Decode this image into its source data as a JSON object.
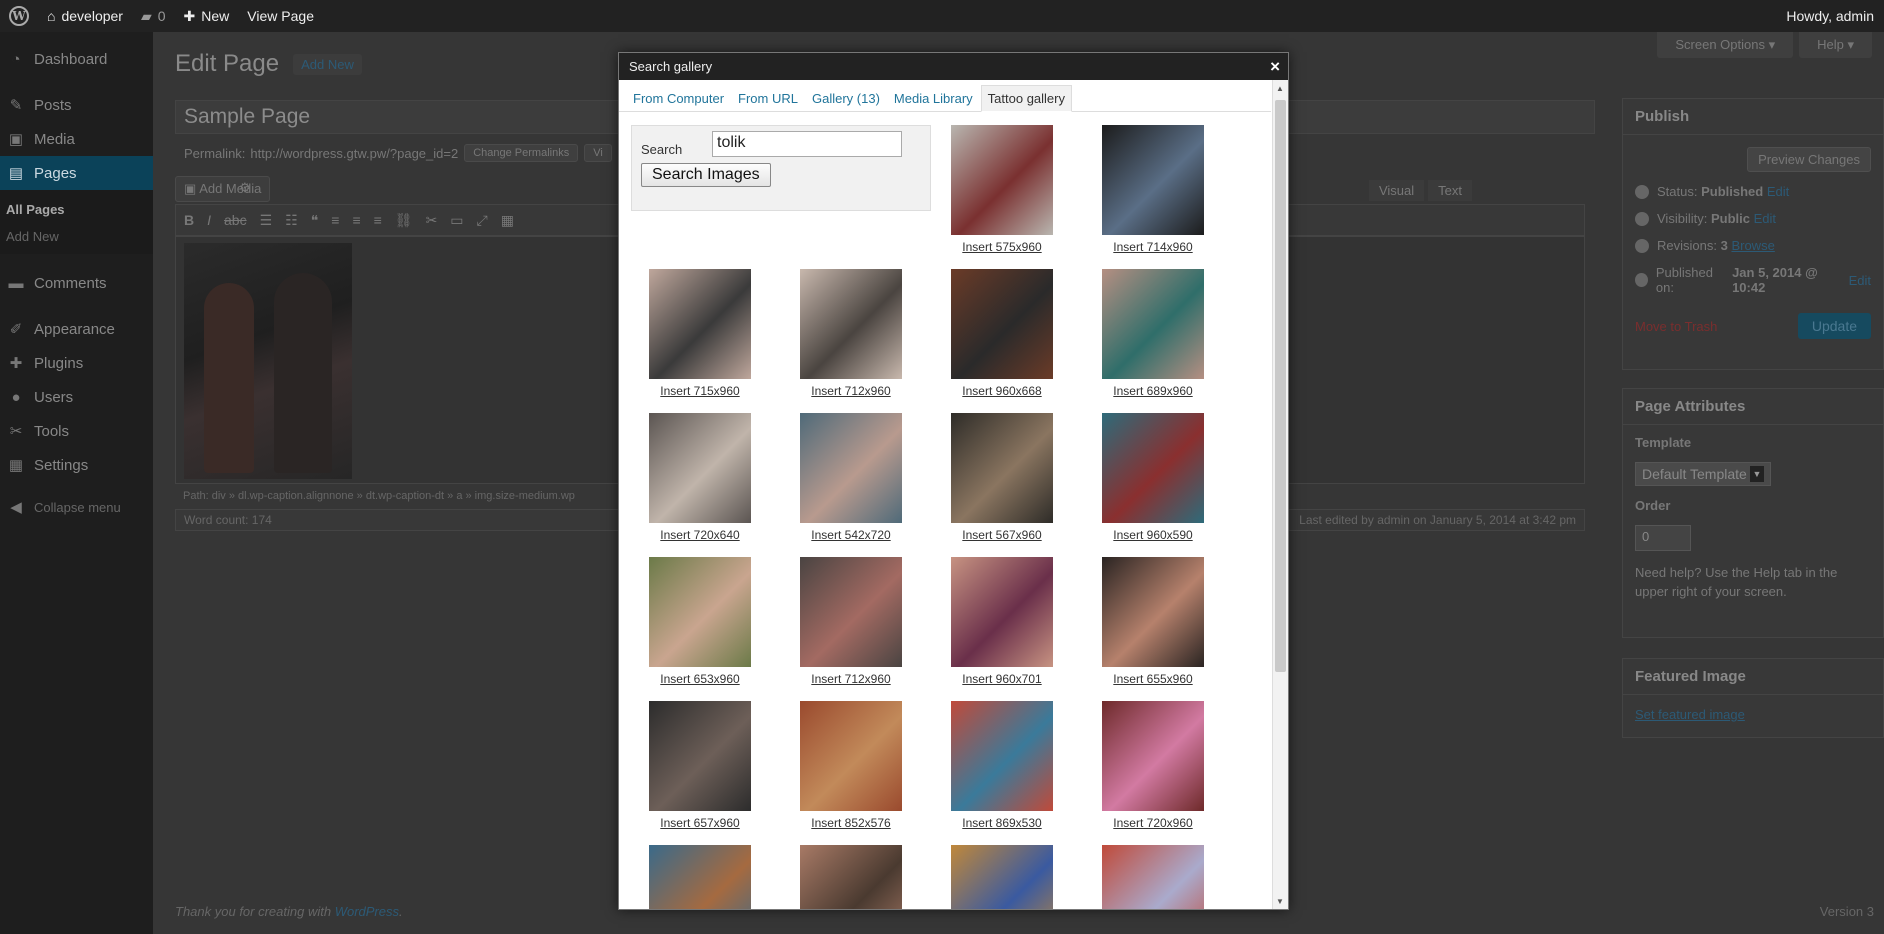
{
  "adminbar": {
    "site": "developer",
    "comments": "0",
    "new": "New",
    "view": "View Page",
    "howdy": "Howdy, admin"
  },
  "sidebar": {
    "items": [
      {
        "label": "Dashboard",
        "icon": "dashboard-icon",
        "glyph": "◔"
      },
      {
        "label": "Posts",
        "icon": "pin-icon",
        "glyph": "✎"
      },
      {
        "label": "Media",
        "icon": "media-icon",
        "glyph": "▣"
      },
      {
        "label": "Pages",
        "icon": "pages-icon",
        "glyph": "▤"
      }
    ],
    "sub": [
      "All Pages",
      "Add New"
    ],
    "items2": [
      {
        "label": "Comments",
        "icon": "comments-icon",
        "glyph": "▬"
      },
      {
        "label": "Appearance",
        "icon": "brush-icon",
        "glyph": "✐"
      },
      {
        "label": "Plugins",
        "icon": "plugin-icon",
        "glyph": "✚"
      },
      {
        "label": "Users",
        "icon": "users-icon",
        "glyph": "●"
      },
      {
        "label": "Tools",
        "icon": "wrench-icon",
        "glyph": "✂"
      },
      {
        "label": "Settings",
        "icon": "settings-icon",
        "glyph": "▦"
      }
    ],
    "collapse": "Collapse menu"
  },
  "page": {
    "title": "Edit Page",
    "add_new": "Add New",
    "screen_options": "Screen Options ▾",
    "help": "Help ▾",
    "post_title": "Sample Page",
    "permalink_label": "Permalink:",
    "permalink_url": "http://wordpress.gtw.pw/?page_id=2",
    "change_permalinks": "Change Permalinks",
    "view_page_short": "Vi",
    "add_media": "Add Media",
    "visual": "Visual",
    "text": "Text",
    "path": "Path: div » dl.wp-caption.alignnone » dt.wp-caption-dt » a » img.size-medium.wp",
    "word_count": "Word count: 174",
    "last_edited": "Last edited by admin on January 5, 2014 at 3:42 pm",
    "footer_text": "Thank you for creating with ",
    "footer_link": "WordPress",
    "version": "Version 3"
  },
  "publish": {
    "title": "Publish",
    "preview": "Preview Changes",
    "status_label": "Status:",
    "status": "Published",
    "visibility_label": "Visibility:",
    "visibility": "Public",
    "revisions_label": "Revisions:",
    "revisions": "3",
    "browse": "Browse",
    "published_label": "Published on:",
    "published": "Jan 5, 2014 @ 10:42",
    "edit": "Edit",
    "trash": "Move to Trash",
    "update": "Update"
  },
  "attributes": {
    "title": "Page Attributes",
    "template_label": "Template",
    "template": "Default Template",
    "order_label": "Order",
    "order": "0",
    "help": "Need help? Use the Help tab in the upper right of your screen."
  },
  "featured": {
    "title": "Featured Image",
    "link": "Set featured image"
  },
  "modal": {
    "title": "Search gallery",
    "close": "×",
    "tabs": [
      "From Computer",
      "From URL",
      "Gallery (13)",
      "Media Library",
      "Tattoo gallery"
    ],
    "active_tab": 4,
    "search_label": "Search",
    "search_value": "tolik",
    "search_button": "Search Images",
    "images": [
      {
        "label": "Insert 575x960",
        "colors": [
          "#b9b6b0",
          "#7a3030"
        ]
      },
      {
        "label": "Insert 714x960",
        "colors": [
          "#1c1c1c",
          "#5a6e86"
        ]
      },
      {
        "label": "Insert 715x960",
        "colors": [
          "#bfa79c",
          "#3a3a3a"
        ]
      },
      {
        "label": "Insert 712x960",
        "colors": [
          "#c8b8ad",
          "#4a4440"
        ]
      },
      {
        "label": "Insert 960x668",
        "colors": [
          "#6b3b28",
          "#2a2a2a"
        ]
      },
      {
        "label": "Insert 689x960",
        "colors": [
          "#b58f82",
          "#2f6e6a"
        ]
      },
      {
        "label": "Insert 720x640",
        "colors": [
          "#5b5552",
          "#c0b4aa"
        ]
      },
      {
        "label": "Insert 542x720",
        "colors": [
          "#4f6a79",
          "#b89a8e"
        ]
      },
      {
        "label": "Insert 567x960",
        "colors": [
          "#2e2c28",
          "#8a7560"
        ]
      },
      {
        "label": "Insert 960x590",
        "colors": [
          "#2e6b7a",
          "#8a2f2f"
        ]
      },
      {
        "label": "Insert 653x960",
        "colors": [
          "#6b7a48",
          "#c9a58f"
        ]
      },
      {
        "label": "Insert 712x960",
        "colors": [
          "#4a4442",
          "#a36a62"
        ]
      },
      {
        "label": "Insert 960x701",
        "colors": [
          "#c79382",
          "#6a2f4a"
        ]
      },
      {
        "label": "Insert 655x960",
        "colors": [
          "#2a2422",
          "#b6816c"
        ]
      },
      {
        "label": "Insert 657x960",
        "colors": [
          "#2c2c2c",
          "#6d5f58"
        ]
      },
      {
        "label": "Insert 852x576",
        "colors": [
          "#9a4a2e",
          "#c28a5a"
        ]
      },
      {
        "label": "Insert 869x530",
        "colors": [
          "#c04a3a",
          "#3a7a9a"
        ]
      },
      {
        "label": "Insert 720x960",
        "colors": [
          "#6e2a2a",
          "#d27aa2"
        ]
      },
      {
        "label": "",
        "colors": [
          "#3a6a8a",
          "#a56a40"
        ]
      },
      {
        "label": "",
        "colors": [
          "#a87a66",
          "#4a3a30"
        ]
      },
      {
        "label": "",
        "colors": [
          "#c0883a",
          "#3a5aa0"
        ]
      },
      {
        "label": "",
        "colors": [
          "#c04a3a",
          "#aaaacc"
        ]
      }
    ]
  }
}
